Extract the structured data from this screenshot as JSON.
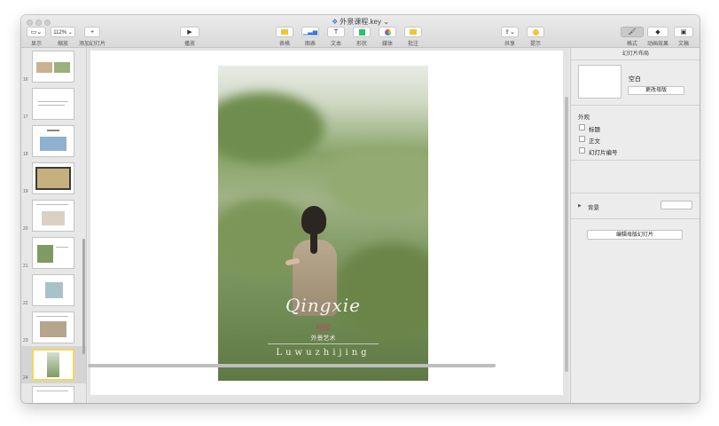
{
  "window": {
    "title": "外景课程.key",
    "title_suffix": "⌄"
  },
  "toolbar": {
    "view": {
      "label": "显示",
      "icon": "sidebar-layout-icon"
    },
    "zoom": {
      "label": "缩放",
      "value": "112% ⌄"
    },
    "add_slide": {
      "label": "添加幻灯片",
      "icon": "plus-icon"
    },
    "play": {
      "label": "播放",
      "icon": "play-icon"
    },
    "table": {
      "label": "表格",
      "icon": "table-icon",
      "color": "#f3c533"
    },
    "chart": {
      "label": "图表",
      "icon": "chart-icon",
      "color": "#3b78d8"
    },
    "text": {
      "label": "文本",
      "icon": "text-icon"
    },
    "shape": {
      "label": "形状",
      "icon": "shape-icon",
      "color": "#2fbf71"
    },
    "media": {
      "label": "媒体",
      "icon": "media-icon"
    },
    "comment": {
      "label": "批注",
      "icon": "comment-icon",
      "color": "#f3c533"
    },
    "share": {
      "label": "共享",
      "icon": "share-icon"
    },
    "tips": {
      "label": "提示",
      "icon": "tips-icon",
      "color": "#f3c533"
    },
    "format": {
      "label": "格式",
      "icon": "format-brush-icon"
    },
    "animate": {
      "label": "动画效果",
      "icon": "animate-icon"
    },
    "document": {
      "label": "文稿",
      "icon": "document-icon"
    }
  },
  "slides": [
    {
      "number": "16"
    },
    {
      "number": "17"
    },
    {
      "number": "18"
    },
    {
      "number": "19"
    },
    {
      "number": "20"
    },
    {
      "number": "21"
    },
    {
      "number": "22"
    },
    {
      "number": "23"
    },
    {
      "number": "24",
      "selected": true
    }
  ],
  "current_slide": {
    "brand": "Qingxie",
    "brand_cn": "轻熙",
    "brand_cn2": "外景艺术",
    "subtitle": "Luwuzhijing"
  },
  "inspector": {
    "header": "幻灯片布局",
    "layout_name": "空白",
    "change_master": "更改母版",
    "appearance": "外观",
    "options": [
      {
        "label": "标题"
      },
      {
        "label": "正文"
      },
      {
        "label": "幻灯片编号"
      }
    ],
    "background": "背景",
    "edit_master": "编辑母版幻灯片"
  }
}
